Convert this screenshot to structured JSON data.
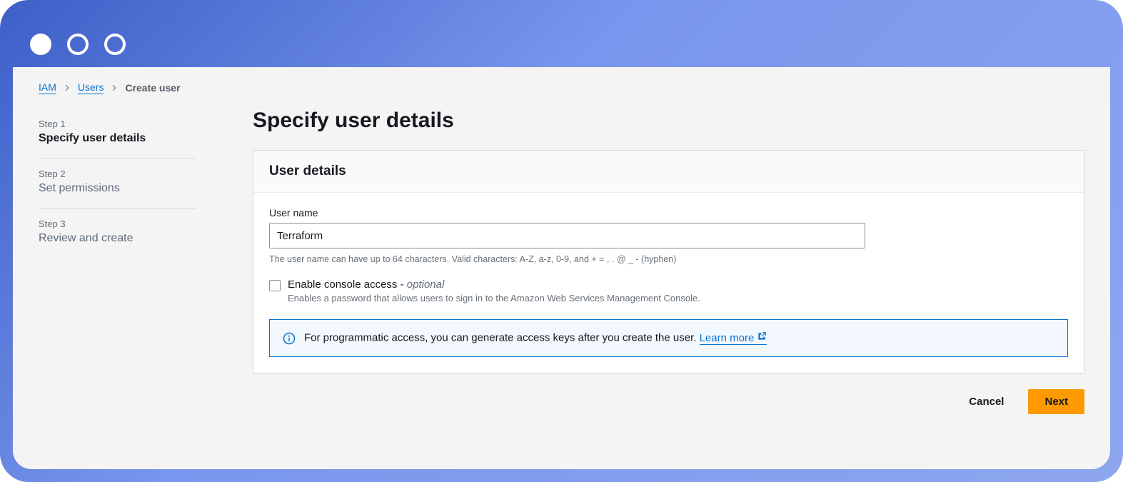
{
  "breadcrumb": {
    "items": [
      {
        "label": "IAM",
        "link": true
      },
      {
        "label": "Users",
        "link": true
      },
      {
        "label": "Create user",
        "link": false
      }
    ]
  },
  "wizard": {
    "steps": [
      {
        "num": "Step 1",
        "title": "Specify user details",
        "active": true
      },
      {
        "num": "Step 2",
        "title": "Set permissions",
        "active": false
      },
      {
        "num": "Step 3",
        "title": "Review and create",
        "active": false
      }
    ]
  },
  "page": {
    "heading": "Specify user details"
  },
  "panel": {
    "title": "User details",
    "username_label": "User name",
    "username_value": "Terraform",
    "username_hint": "The user name can have up to 64 characters. Valid characters: A-Z, a-z, 0-9, and + = , . @ _ - (hyphen)",
    "console_access_label": "Enable console access - ",
    "console_access_optional": "optional",
    "console_access_desc": "Enables a password that allows users to sign in to the Amazon Web Services Management Console.",
    "alert_text": "For programmatic access, you can generate access keys after you create the user. ",
    "alert_link": "Learn more"
  },
  "buttons": {
    "cancel": "Cancel",
    "next": "Next"
  }
}
